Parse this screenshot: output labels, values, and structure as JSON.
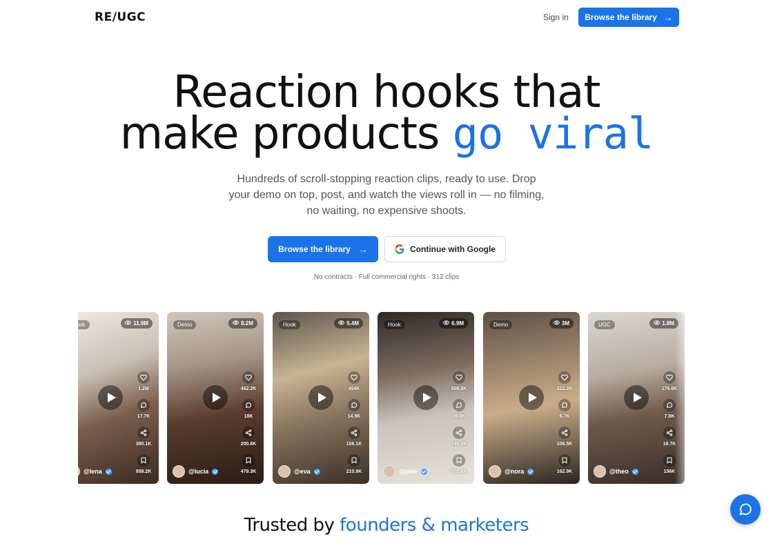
{
  "header": {
    "logo": "RE/UGC",
    "sign_in": "Sign in",
    "browse_label": "Browse the library",
    "browse_arrow": "→"
  },
  "hero": {
    "title_line1": "Reaction hooks that",
    "title_line2_plain": "make products",
    "title_line2_accent": "go viral",
    "subtitle": "Hundreds of scroll-stopping reaction clips, ready to use. Drop your demo on top, post, and watch the views roll in — no filming, no waiting, no expensive shoots.",
    "browse_label": "Browse the library",
    "browse_arrow": "→",
    "google_label": "Continue with Google",
    "notes": "No contracts · Full commercial rights · 312 clips"
  },
  "cards": [
    {
      "tag": "Hook",
      "views": "11.9M",
      "likes": "1.2M",
      "comments": "17.7K",
      "shares": "380.1K",
      "saves": "958.2K",
      "user": "@lena"
    },
    {
      "tag": "Demo",
      "views": "8.2M",
      "likes": "462.2K",
      "comments": "18K",
      "shares": "200.6K",
      "saves": "479.3K",
      "user": "@lucia"
    },
    {
      "tag": "Hook",
      "views": "5.4M",
      "likes": "454K",
      "comments": "14.9K",
      "shares": "156.1K",
      "saves": "210.9K",
      "user": "@eva"
    },
    {
      "tag": "Hook",
      "views": "6.9M",
      "likes": "508.5K",
      "comments": "26.8K",
      "shares": "146.9K",
      "saves": "508.8K",
      "user": "@jade"
    },
    {
      "tag": "Demo",
      "views": "3M",
      "likes": "222.2K",
      "comments": "6.7K",
      "shares": "106.5K",
      "saves": "162.9K",
      "user": "@nora"
    },
    {
      "tag": "UGC",
      "views": "1.8M",
      "likes": "176.6K",
      "comments": "7.8K",
      "shares": "18.7K",
      "saves": "156K",
      "user": "@theo"
    }
  ],
  "trusted": {
    "plain": "Trusted by",
    "accent": "founders & marketers"
  },
  "colors": {
    "accent": "#1a73e8"
  },
  "icons": [
    "arrow-right-icon",
    "google-icon",
    "eye-icon",
    "heart-icon",
    "comment-icon",
    "share-icon",
    "bookmark-icon",
    "play-icon",
    "verified-icon",
    "chat-icon"
  ]
}
